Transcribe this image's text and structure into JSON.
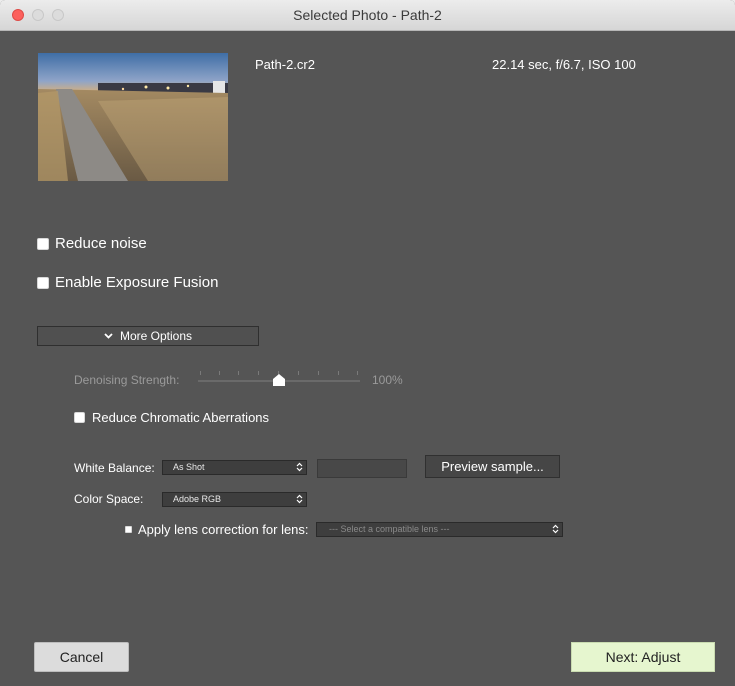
{
  "window": {
    "title": "Selected Photo - Path-2"
  },
  "photo": {
    "filename": "Path-2.cr2",
    "exposure": "22.14 sec, f/6.7, ISO 100"
  },
  "options": {
    "reduce_noise_label": "Reduce noise",
    "reduce_noise_checked": false,
    "exposure_fusion_label": "Enable Exposure Fusion",
    "exposure_fusion_checked": false,
    "more_options_label": "More Options"
  },
  "more": {
    "denoise_label": "Denoising Strength:",
    "denoise_value_text": "100%",
    "denoise_value": 0.5,
    "chroma_label": "Reduce Chromatic Aberrations",
    "chroma_checked": false,
    "white_balance_label": "White Balance:",
    "white_balance_value": "As Shot",
    "preview_button": "Preview sample...",
    "color_space_label": "Color Space:",
    "color_space_value": "Adobe RGB",
    "lens_label": "Apply lens correction for lens:",
    "lens_checked": false,
    "lens_value": "--- Select a compatible lens ---"
  },
  "footer": {
    "cancel_label": "Cancel",
    "next_label": "Next: Adjust"
  },
  "colors": {
    "background": "#555555",
    "next_button": "#e6f6cf",
    "close_button": "#fc605c"
  },
  "icons": {
    "chevron": "chevron-down-icon",
    "select_arrows": "up-down-arrows-icon",
    "slider_knob": "slider-knob-icon"
  }
}
